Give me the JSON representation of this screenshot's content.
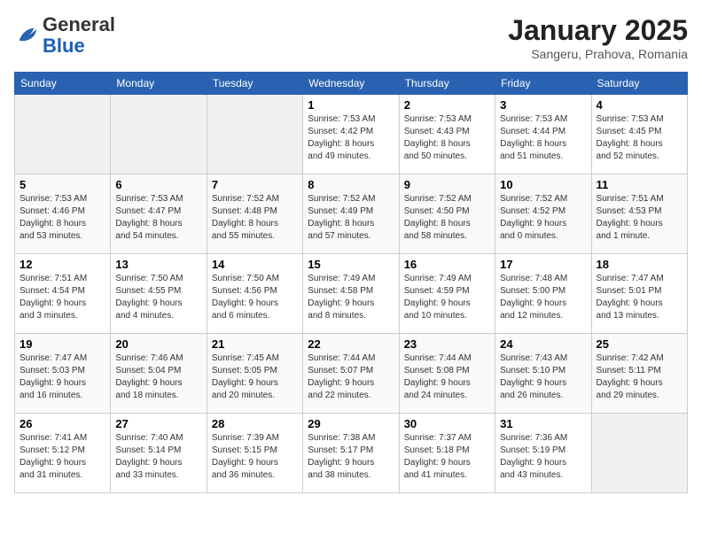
{
  "logo": {
    "general": "General",
    "blue": "Blue"
  },
  "title": "January 2025",
  "location": "Sangeru, Prahova, Romania",
  "weekdays": [
    "Sunday",
    "Monday",
    "Tuesday",
    "Wednesday",
    "Thursday",
    "Friday",
    "Saturday"
  ],
  "weeks": [
    [
      {
        "day": "",
        "info": ""
      },
      {
        "day": "",
        "info": ""
      },
      {
        "day": "",
        "info": ""
      },
      {
        "day": "1",
        "info": "Sunrise: 7:53 AM\nSunset: 4:42 PM\nDaylight: 8 hours\nand 49 minutes."
      },
      {
        "day": "2",
        "info": "Sunrise: 7:53 AM\nSunset: 4:43 PM\nDaylight: 8 hours\nand 50 minutes."
      },
      {
        "day": "3",
        "info": "Sunrise: 7:53 AM\nSunset: 4:44 PM\nDaylight: 8 hours\nand 51 minutes."
      },
      {
        "day": "4",
        "info": "Sunrise: 7:53 AM\nSunset: 4:45 PM\nDaylight: 8 hours\nand 52 minutes."
      }
    ],
    [
      {
        "day": "5",
        "info": "Sunrise: 7:53 AM\nSunset: 4:46 PM\nDaylight: 8 hours\nand 53 minutes."
      },
      {
        "day": "6",
        "info": "Sunrise: 7:53 AM\nSunset: 4:47 PM\nDaylight: 8 hours\nand 54 minutes."
      },
      {
        "day": "7",
        "info": "Sunrise: 7:52 AM\nSunset: 4:48 PM\nDaylight: 8 hours\nand 55 minutes."
      },
      {
        "day": "8",
        "info": "Sunrise: 7:52 AM\nSunset: 4:49 PM\nDaylight: 8 hours\nand 57 minutes."
      },
      {
        "day": "9",
        "info": "Sunrise: 7:52 AM\nSunset: 4:50 PM\nDaylight: 8 hours\nand 58 minutes."
      },
      {
        "day": "10",
        "info": "Sunrise: 7:52 AM\nSunset: 4:52 PM\nDaylight: 9 hours\nand 0 minutes."
      },
      {
        "day": "11",
        "info": "Sunrise: 7:51 AM\nSunset: 4:53 PM\nDaylight: 9 hours\nand 1 minute."
      }
    ],
    [
      {
        "day": "12",
        "info": "Sunrise: 7:51 AM\nSunset: 4:54 PM\nDaylight: 9 hours\nand 3 minutes."
      },
      {
        "day": "13",
        "info": "Sunrise: 7:50 AM\nSunset: 4:55 PM\nDaylight: 9 hours\nand 4 minutes."
      },
      {
        "day": "14",
        "info": "Sunrise: 7:50 AM\nSunset: 4:56 PM\nDaylight: 9 hours\nand 6 minutes."
      },
      {
        "day": "15",
        "info": "Sunrise: 7:49 AM\nSunset: 4:58 PM\nDaylight: 9 hours\nand 8 minutes."
      },
      {
        "day": "16",
        "info": "Sunrise: 7:49 AM\nSunset: 4:59 PM\nDaylight: 9 hours\nand 10 minutes."
      },
      {
        "day": "17",
        "info": "Sunrise: 7:48 AM\nSunset: 5:00 PM\nDaylight: 9 hours\nand 12 minutes."
      },
      {
        "day": "18",
        "info": "Sunrise: 7:47 AM\nSunset: 5:01 PM\nDaylight: 9 hours\nand 13 minutes."
      }
    ],
    [
      {
        "day": "19",
        "info": "Sunrise: 7:47 AM\nSunset: 5:03 PM\nDaylight: 9 hours\nand 16 minutes."
      },
      {
        "day": "20",
        "info": "Sunrise: 7:46 AM\nSunset: 5:04 PM\nDaylight: 9 hours\nand 18 minutes."
      },
      {
        "day": "21",
        "info": "Sunrise: 7:45 AM\nSunset: 5:05 PM\nDaylight: 9 hours\nand 20 minutes."
      },
      {
        "day": "22",
        "info": "Sunrise: 7:44 AM\nSunset: 5:07 PM\nDaylight: 9 hours\nand 22 minutes."
      },
      {
        "day": "23",
        "info": "Sunrise: 7:44 AM\nSunset: 5:08 PM\nDaylight: 9 hours\nand 24 minutes."
      },
      {
        "day": "24",
        "info": "Sunrise: 7:43 AM\nSunset: 5:10 PM\nDaylight: 9 hours\nand 26 minutes."
      },
      {
        "day": "25",
        "info": "Sunrise: 7:42 AM\nSunset: 5:11 PM\nDaylight: 9 hours\nand 29 minutes."
      }
    ],
    [
      {
        "day": "26",
        "info": "Sunrise: 7:41 AM\nSunset: 5:12 PM\nDaylight: 9 hours\nand 31 minutes."
      },
      {
        "day": "27",
        "info": "Sunrise: 7:40 AM\nSunset: 5:14 PM\nDaylight: 9 hours\nand 33 minutes."
      },
      {
        "day": "28",
        "info": "Sunrise: 7:39 AM\nSunset: 5:15 PM\nDaylight: 9 hours\nand 36 minutes."
      },
      {
        "day": "29",
        "info": "Sunrise: 7:38 AM\nSunset: 5:17 PM\nDaylight: 9 hours\nand 38 minutes."
      },
      {
        "day": "30",
        "info": "Sunrise: 7:37 AM\nSunset: 5:18 PM\nDaylight: 9 hours\nand 41 minutes."
      },
      {
        "day": "31",
        "info": "Sunrise: 7:36 AM\nSunset: 5:19 PM\nDaylight: 9 hours\nand 43 minutes."
      },
      {
        "day": "",
        "info": ""
      }
    ]
  ]
}
